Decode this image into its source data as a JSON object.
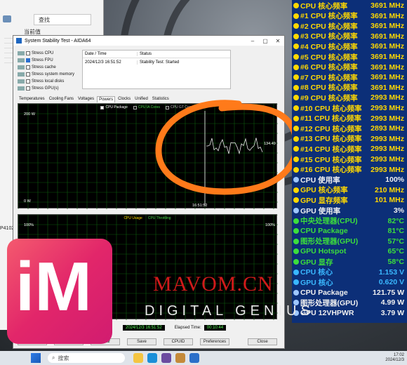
{
  "explorer": {
    "search_placeholder": "查找",
    "current_label": "当前值",
    "side_tag": "P4102"
  },
  "aida": {
    "title": "System Stability Test - AIDA64",
    "stress_items": [
      {
        "label": "Stress CPU",
        "checked": false
      },
      {
        "label": "Stress FPU",
        "checked": true
      },
      {
        "label": "Stress cache",
        "checked": false
      },
      {
        "label": "Stress system memory",
        "checked": false
      },
      {
        "label": "Stress local disks",
        "checked": false
      },
      {
        "label": "Stress GPU(s)",
        "checked": false
      }
    ],
    "status_headers": [
      "Date / Time",
      "Status"
    ],
    "status_row": {
      "time": "2024/12/3 16:51:52",
      "status": "Stability Test: Started"
    },
    "tabs": [
      "Temperatures",
      "Cooling Fans",
      "Voltages",
      "Powers",
      "Clocks",
      "Unified",
      "Statistics"
    ],
    "active_tab": "Powers",
    "graph1": {
      "legend": [
        "CPU Package",
        "CPU IA Cores",
        "CPU GT Cores"
      ],
      "ymax": "200 W",
      "ymin": "0 W",
      "time_label": "16:51:52",
      "current_value": "134.49"
    },
    "graph2": {
      "legend": [
        "CPU Usage",
        "CPU Throttling"
      ],
      "ymax_left": "100%",
      "ymax_right": "100%"
    },
    "bottom": {
      "test_started_value": "2024/12/3 16:51:52",
      "elapsed_label": "Elapsed Time:",
      "elapsed_value": "00:10:44"
    },
    "buttons": [
      "Start",
      "Stop",
      "Clear",
      "Save",
      "CPUID",
      "Preferences",
      "Close"
    ]
  },
  "monitor": {
    "rows": [
      {
        "label": "CPU 核心频率",
        "value": "3691 MHz",
        "color": "yellow"
      },
      {
        "label": "#1 CPU 核心频率",
        "value": "3691 MHz",
        "color": "yellow"
      },
      {
        "label": "#2 CPU 核心频率",
        "value": "3691 MHz",
        "color": "yellow"
      },
      {
        "label": "#3 CPU 核心频率",
        "value": "3691 MHz",
        "color": "yellow"
      },
      {
        "label": "#4 CPU 核心频率",
        "value": "3691 MHz",
        "color": "yellow"
      },
      {
        "label": "#5 CPU 核心频率",
        "value": "3691 MHz",
        "color": "yellow"
      },
      {
        "label": "#6 CPU 核心频率",
        "value": "3691 MHz",
        "color": "yellow"
      },
      {
        "label": "#7 CPU 核心频率",
        "value": "3691 MHz",
        "color": "yellow"
      },
      {
        "label": "#8 CPU 核心频率",
        "value": "3691 MHz",
        "color": "yellow"
      },
      {
        "label": "#9 CPU 核心频率",
        "value": "2993 MHz",
        "color": "yellow"
      },
      {
        "label": "#10 CPU 核心频率",
        "value": "2993 MHz",
        "color": "yellow"
      },
      {
        "label": "#11 CPU 核心频率",
        "value": "2993 MHz",
        "color": "yellow"
      },
      {
        "label": "#12 CPU 核心频率",
        "value": "2893 MHz",
        "color": "yellow"
      },
      {
        "label": "#13 CPU 核心频率",
        "value": "2993 MHz",
        "color": "yellow"
      },
      {
        "label": "#14 CPU 核心频率",
        "value": "2993 MHz",
        "color": "yellow"
      },
      {
        "label": "#15 CPU 核心频率",
        "value": "2993 MHz",
        "color": "yellow"
      },
      {
        "label": "#16 CPU 核心频率",
        "value": "2993 MHz",
        "color": "yellow"
      },
      {
        "label": "CPU 使用率",
        "value": "100%",
        "color": "white"
      },
      {
        "label": "GPU 核心频率",
        "value": "210 MHz",
        "color": "yellow"
      },
      {
        "label": "GPU 显存频率",
        "value": "101 MHz",
        "color": "yellow"
      },
      {
        "label": "GPU 使用率",
        "value": "3%",
        "color": "white"
      },
      {
        "label": "中央处理器(CPU)",
        "value": "82°C",
        "color": "green"
      },
      {
        "label": "CPU Package",
        "value": "81°C",
        "color": "green"
      },
      {
        "label": "图形处理器(GPU)",
        "value": "57°C",
        "color": "green"
      },
      {
        "label": "GPU Hotspot",
        "value": "65°C",
        "color": "green"
      },
      {
        "label": "GPU 显存",
        "value": "58°C",
        "color": "green"
      },
      {
        "label": "CPU 核心",
        "value": "1.153 V",
        "color": "cyan"
      },
      {
        "label": "GPU 核心",
        "value": "0.620 V",
        "color": "cyan"
      },
      {
        "label": "CPU Package",
        "value": "121.75 W",
        "color": "white"
      },
      {
        "label": "图形处理器(GPU)",
        "value": "4.99 W",
        "color": "white"
      },
      {
        "label": "GPU 12VHPWR",
        "value": "3.79 W",
        "color": "white"
      }
    ]
  },
  "watermark": {
    "logo": "iM",
    "site": "MAVOM.CN",
    "tagline": "DIGITAL GENIUS"
  },
  "taskbar": {
    "search_placeholder": "搜索",
    "time": "17:02",
    "date": "2024/12/3"
  },
  "colors": {
    "monitor_bg": "#0c2f78",
    "yellow": "#ffd800",
    "green": "#3cde3c",
    "cyan": "#3ab8ff",
    "logo_pink": "#e2266a",
    "overlay_orange": "#ff7a1a"
  }
}
